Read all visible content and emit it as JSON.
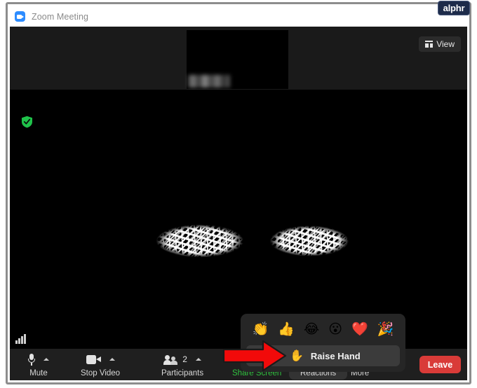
{
  "window": {
    "title": "Zoom Meeting",
    "app_icon": "zoom-video-icon"
  },
  "watermark": {
    "label": "alphr"
  },
  "stage": {
    "view_button": {
      "label": "View",
      "icon": "grid-view-icon"
    },
    "security_icon": "green-shield-check-icon",
    "thumbnail": {
      "name_label": "",
      "state": "video-off-black-tile"
    },
    "center_participant_name": ""
  },
  "reactions_popup": {
    "emojis": [
      {
        "name": "clapping-hands-emoji",
        "glyph": "👏"
      },
      {
        "name": "thumbs-up-emoji",
        "glyph": "👍"
      },
      {
        "name": "face-with-tears-of-joy-emoji",
        "glyph": "😂"
      },
      {
        "name": "open-mouth-emoji",
        "glyph": "😮"
      },
      {
        "name": "red-heart-emoji",
        "glyph": "❤️"
      },
      {
        "name": "party-popper-emoji",
        "glyph": "🎉"
      }
    ],
    "raise_hand": {
      "label": "Raise Hand",
      "emoji": "✋"
    }
  },
  "annotation": {
    "arrow_color": "#f20a0a",
    "points_to": "Raise Hand"
  },
  "toolbar": {
    "signal_icon": "network-signal-bars-icon",
    "items": [
      {
        "name": "mute",
        "label": "Mute",
        "icon": "microphone-icon",
        "has_caret": true
      },
      {
        "name": "stop-video",
        "label": "Stop Video",
        "icon": "camera-icon",
        "has_caret": true
      },
      {
        "name": "participants",
        "label": "Participants",
        "icon": "people-icon",
        "count": "2",
        "has_caret": true
      },
      {
        "name": "share-screen",
        "label": "Share Screen",
        "icon": "share-screen-arrow-icon",
        "has_caret": false
      },
      {
        "name": "reactions",
        "label": "Reactions",
        "icon": "smiley-plus-icon",
        "has_caret": false,
        "active": true
      },
      {
        "name": "more",
        "label": "More",
        "icon": "ellipsis-icon",
        "has_caret": false
      }
    ],
    "leave_label": "Leave",
    "share_screen_color": "#30c23f",
    "leave_color": "#d93b38"
  }
}
